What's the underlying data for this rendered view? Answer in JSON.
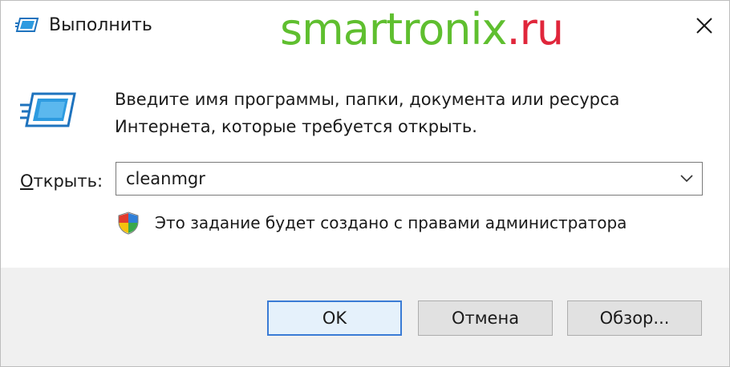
{
  "window": {
    "title": "Выполнить",
    "close_glyph": "✕",
    "watermark_main": "smartronix",
    "watermark_tld": ".ru"
  },
  "body": {
    "description_line1": "Введите имя программы, папки, документа или ресурса",
    "description_line2": "Интернета, которые требуется открыть.",
    "open_label_mnemonic": "О",
    "open_label_rest": "ткрыть:",
    "open_value": "cleanmgr",
    "admin_note": "Это задание будет создано с правами администратора"
  },
  "buttons": {
    "ok": "OK",
    "cancel": "Отмена",
    "browse": "Обзор..."
  },
  "icons": {
    "title": "run-icon",
    "big": "run-icon",
    "admin": "shield-icon",
    "dropdown": "chevron-down-icon",
    "close": "close-icon"
  },
  "colors": {
    "accent": "#3a7bd5",
    "watermark_green": "#5fbf2f",
    "watermark_red": "#e0263b",
    "footer_bg": "#f0f0f0"
  }
}
